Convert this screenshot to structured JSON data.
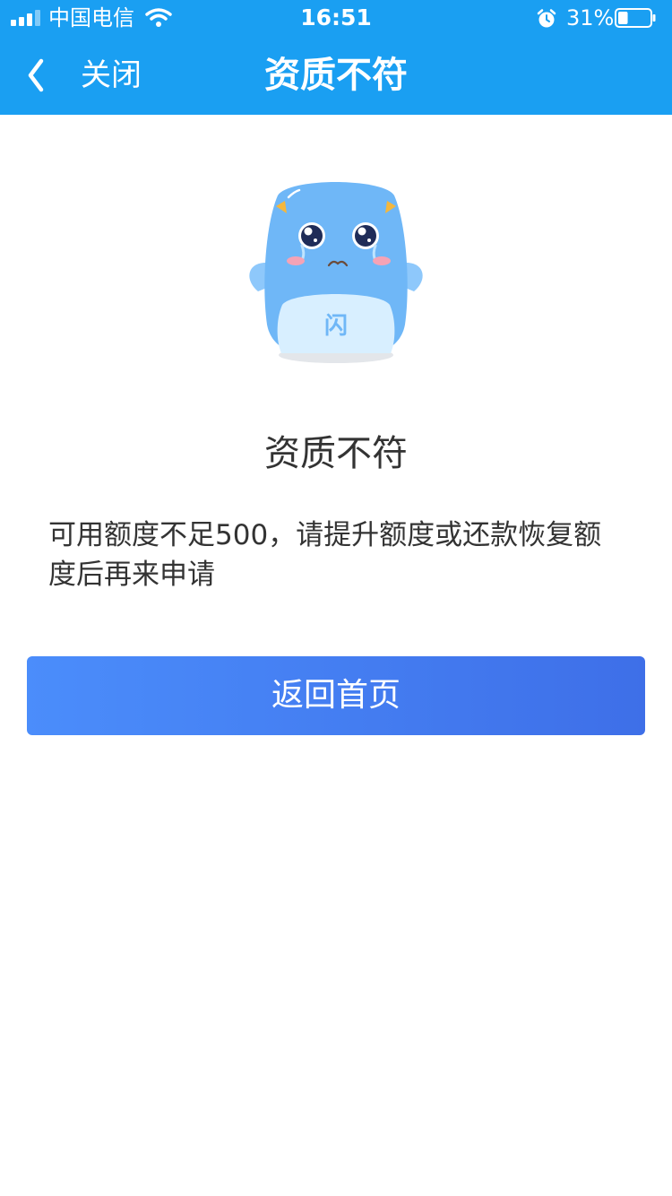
{
  "status_bar": {
    "carrier": "中国电信",
    "time": "16:51",
    "battery_percent": "31%",
    "battery_level": 0.31,
    "icons": [
      "signal-icon",
      "wifi-icon",
      "alarm-icon",
      "battery-icon"
    ]
  },
  "nav": {
    "back_icon": "chevron-left-icon",
    "close_label": "关闭",
    "title": "资质不符"
  },
  "mascot": {
    "badge_text": "闪"
  },
  "result": {
    "title": "资质不符",
    "description": "可用额度不足500，请提升额度或还款恢复额度后再来申请"
  },
  "actions": {
    "home_button_label": "返回首页"
  },
  "colors": {
    "header_bg": "#1a9ff2",
    "button_gradient_start": "#4b8dfb",
    "button_gradient_end": "#3e6fe8",
    "text_primary": "#333333",
    "mascot_body": "#6fb7f7"
  }
}
